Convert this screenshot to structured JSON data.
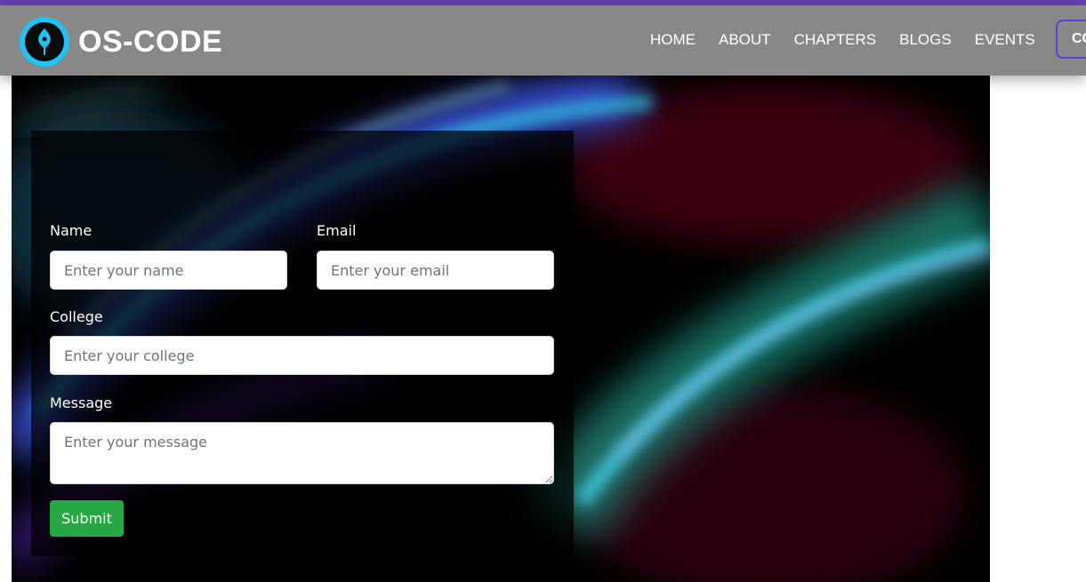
{
  "brand": {
    "name": "OS-CODE",
    "logo_icon": "quill-pen-icon",
    "logo_color": "#1ec4f4"
  },
  "nav": {
    "items": [
      "HOME",
      "ABOUT",
      "CHAPTERS",
      "BLOGS",
      "EVENTS"
    ],
    "cta_label": "CO"
  },
  "colors": {
    "top_strip": "#6a3fb5",
    "navbar_bg": "#888888",
    "cta_border": "#5b3fd6",
    "submit_bg": "#28a745"
  },
  "form": {
    "name_label": "Name",
    "name_placeholder": "Enter your name",
    "email_label": "Email",
    "email_placeholder": "Enter your email",
    "college_label": "College",
    "college_placeholder": "Enter your college",
    "message_label": "Message",
    "message_placeholder": "Enter your message",
    "submit_label": "Submit"
  }
}
